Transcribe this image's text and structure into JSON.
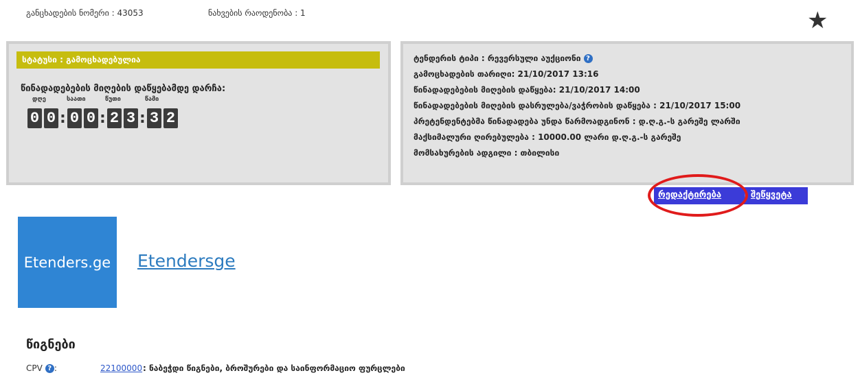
{
  "header": {
    "application_number": "განცხადების ნომერი : 43053",
    "view_count": "ნახვების რაოდენობა : 1",
    "favorite_icon": "star-icon"
  },
  "status_panel": {
    "status": "სტატუსი : გამოცხადებულია",
    "remaining_label": "წინადადებების მიღების დაწყებამდე დარჩა:",
    "units": {
      "days": "დღე",
      "hours": "საათი",
      "minutes": "წუთი",
      "seconds": "წამი"
    },
    "digits": [
      "0",
      "0",
      "0",
      "0",
      "2",
      "3",
      "3",
      "2"
    ]
  },
  "info_panel": {
    "tender_type": "ტენდერის ტიპი : რევერსული აუქციონი",
    "announce_date": "გამოცხადების თარიღი: 21/10/2017 13:16",
    "offers_start": "წინადადებების მიღების დაწყება: 21/10/2017 14:00",
    "offers_end": "წინადადებების მიღების დასრულება/ვაჭრობის დაწყება : 21/10/2017 15:00",
    "vat_note": "პრეტენდენტებმა წინადადება უნდა წარმოადგინონ : დ.ღ.გ.-ს გარეშე ლარში",
    "max_price": "მაქსიმალური ღირებულება : 10000.00 ლარი დ.ღ.გ.-ს გარეშე",
    "location": "მომსახურების ადგილი : თბილისი",
    "help_icon": "question-circle-icon"
  },
  "actions": {
    "edit": "რედაქტირება",
    "separator": "|",
    "stop": "შეწყვეტა"
  },
  "organization": {
    "logo_text": "Etenders.ge",
    "name": "Etendersge"
  },
  "category": {
    "title": "წიგნები",
    "cpv_label": "CPV",
    "cpv_code": "22100000",
    "cpv_description": ": ნაბეჭდი წიგნები, ბროშურები და საინფორმაციო ფურცლები"
  },
  "colors": {
    "status_bar": "#c6bd0f",
    "action_bar": "#3b3bd8",
    "highlight_ellipse": "#e01b1b",
    "logo_bg": "#2f85d4",
    "link": "#2c7bbf"
  }
}
